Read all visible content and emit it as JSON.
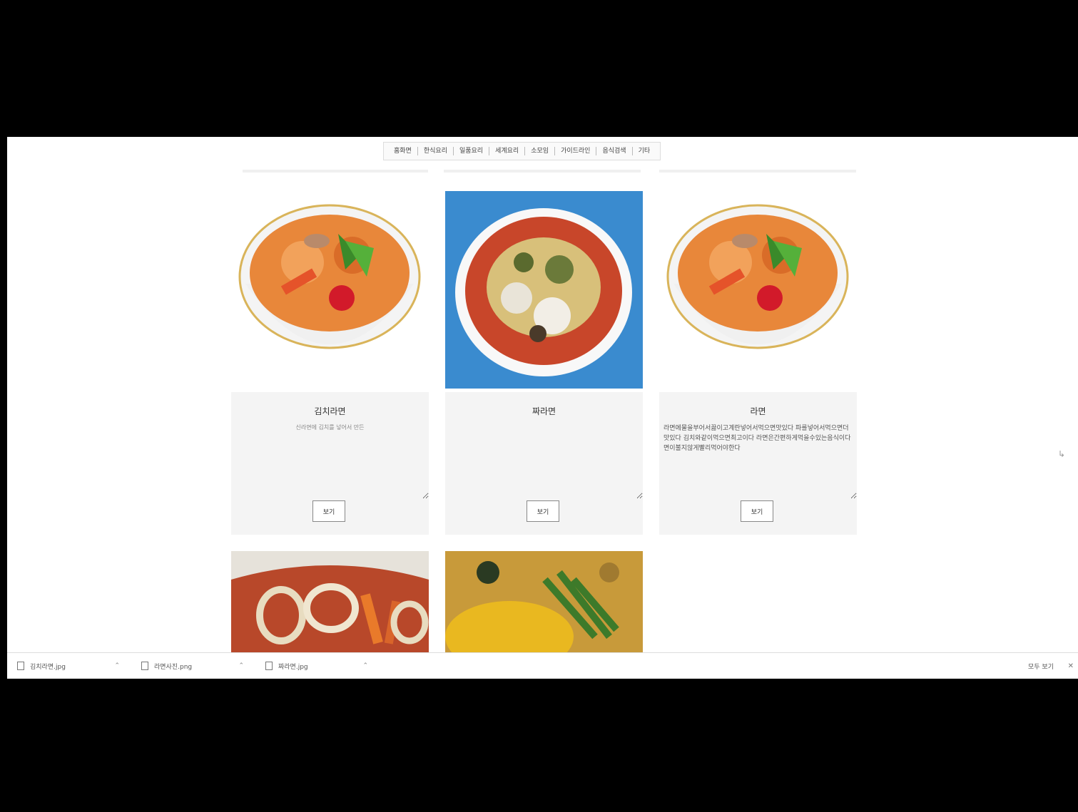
{
  "nav": {
    "items": [
      "홈화면",
      "한식요리",
      "일품요리",
      "세계요리",
      "소모임",
      "가이드라인",
      "음식검색",
      "기타"
    ]
  },
  "cards": [
    {
      "name": "김치라면",
      "desc": "신라면에 김치를 넣어서 만든",
      "button": "보기"
    },
    {
      "name": "짜라면",
      "desc": "",
      "button": "보기"
    },
    {
      "name": "라면",
      "desc": "라면에물을부어서끓이고계란넣어서먹으면맛있다 파를넣어서먹으면더맛있다 김치와같이먹으면최고이다 라면은간편하게먹을수있는음식이다 면이불지않게빨리먹어야한다",
      "button": "보기"
    }
  ],
  "downloads": [
    {
      "name": "김치라면.jpg"
    },
    {
      "name": "라면사진.png"
    },
    {
      "name": "짜라면.jpg"
    }
  ],
  "download_bar": {
    "show_all": "모두 보기"
  }
}
